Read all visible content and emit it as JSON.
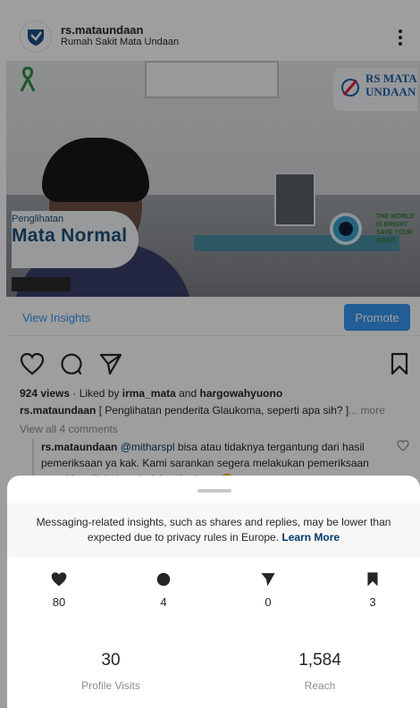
{
  "post": {
    "username": "rs.mataundaan",
    "subtitle": "Rumah Sakit Mata Undaan",
    "photo": {
      "brand_line1": "RS MATA",
      "brand_line2": "UNDAAN",
      "caption_small": "Penglihatan",
      "caption_big": "Mata Normal",
      "world_line1": "THE WORLD",
      "world_line2": "IS BRIGHT",
      "world_line3": "SAVE YOUR",
      "world_line4": "SIGHT"
    },
    "view_insights_label": "View Insights",
    "promote_label": "Promote",
    "views": "924 views",
    "liked_by_prefix": " · Liked by ",
    "liked_by_user1": "irma_mata",
    "liked_by_and": " and ",
    "liked_by_user2": "hargowahyuono",
    "caption_user": "rs.mataundaan",
    "caption_text": " [ Penglihatan penderita Glaukoma, seperti apa sih? ]",
    "caption_more": "... more",
    "view_comments": "View all 4 comments",
    "comment": {
      "user": "rs.mataundaan",
      "mention": "@mitharspl",
      "text": " bisa atau tidaknya tergantung dari hasil pemeriksaan ya kak. Kami sarankan segera melakukan pemeriksaan agar bisa dilakukan tindakan lanjutan 😊"
    }
  },
  "sheet": {
    "notice_text": "Messaging-related insights, such as shares and replies, may be lower than expected due to privacy rules in Europe. ",
    "learn_more_label": "Learn More",
    "stats": [
      {
        "icon": "heart-icon",
        "value": "80"
      },
      {
        "icon": "comment-icon",
        "value": "4"
      },
      {
        "icon": "send-icon",
        "value": "0"
      },
      {
        "icon": "bookmark-icon",
        "value": "3"
      }
    ],
    "profile_visits": {
      "value": "30",
      "label": "Profile Visits"
    },
    "reach": {
      "value": "1,584",
      "label": "Reach"
    }
  },
  "colors": {
    "accent": "#3897f0",
    "link": "#00376b",
    "muted": "#8e8e8e"
  }
}
